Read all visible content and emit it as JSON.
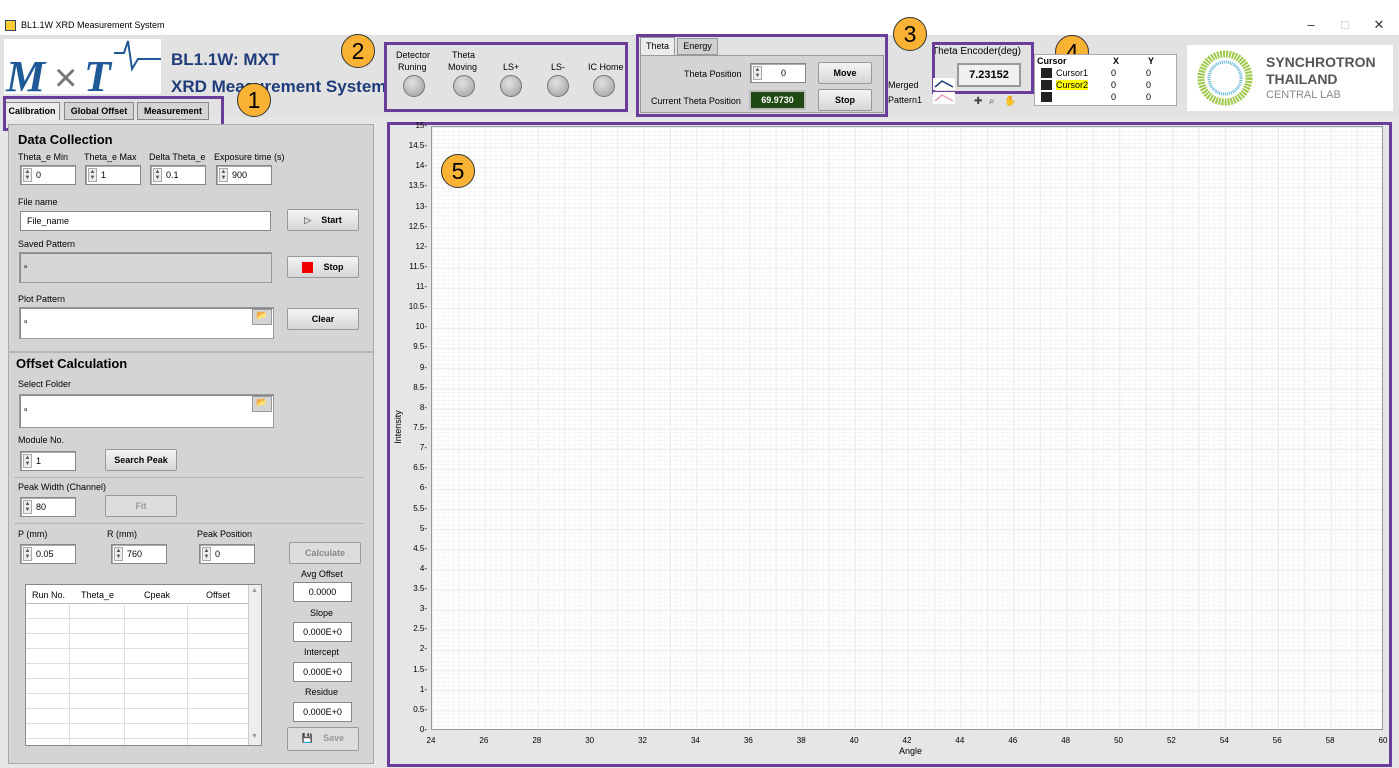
{
  "window": {
    "title": "BL1.1W XRD Measurement System",
    "min": "–",
    "max": "□",
    "close": "✕"
  },
  "header": {
    "line1": "BL1.1W: MXT",
    "line2": "XRD Measurement System"
  },
  "tabs": [
    "Calibration",
    "Global Offset",
    "Measurement"
  ],
  "badges": [
    "1",
    "2",
    "3",
    "4",
    "5"
  ],
  "indicators": [
    {
      "l1": "Detector",
      "l2": "Runing"
    },
    {
      "l1": "Theta",
      "l2": "Moving"
    },
    {
      "l1": "",
      "l2": "LS+"
    },
    {
      "l1": "",
      "l2": "LS-"
    },
    {
      "l1": "",
      "l2": "IC Home"
    }
  ],
  "motor": {
    "tabs": [
      "Theta",
      "Energy"
    ],
    "theta_position_label": "Theta Position",
    "theta_position_value": "0",
    "current_theta_label": "Current Theta Position",
    "current_theta_value": "69.9730",
    "move": "Move",
    "stop": "Stop"
  },
  "encoder": {
    "label": "Theta Encoder(deg)",
    "value": "7.23152"
  },
  "legend": {
    "merged": "Merged",
    "pattern1": "Pattern1"
  },
  "cursors": {
    "header": [
      "Cursor",
      "X",
      "Y"
    ],
    "rows": [
      {
        "name": "Cursor1",
        "x": "0",
        "y": "0"
      },
      {
        "name": "Cursor2",
        "x": "0",
        "y": "0"
      },
      {
        "name": "",
        "x": "0",
        "y": "0"
      }
    ]
  },
  "sponsor": {
    "line1": "SYNCHROTRON",
    "line2": "THAILAND",
    "line3": "CENTRAL LAB"
  },
  "data_collection": {
    "title": "Data Collection",
    "fields": [
      {
        "label": "Theta_e Min",
        "value": "0"
      },
      {
        "label": "Theta_e Max",
        "value": "1"
      },
      {
        "label": "Delta Theta_e",
        "value": "0.1"
      },
      {
        "label": "Exposure time (s)",
        "value": "900"
      }
    ],
    "file_name_label": "File name",
    "file_name": "File_name",
    "start": "Start",
    "saved_pattern_label": "Saved Pattern",
    "stop": "Stop",
    "plot_pattern_label": "Plot Pattern",
    "clear": "Clear"
  },
  "offset": {
    "title": "Offset Calculation",
    "select_folder_label": "Select Folder",
    "module_label": "Module No.",
    "module_value": "1",
    "search_peak": "Search Peak",
    "peak_width_label": "Peak Width (Channel)",
    "peak_width_value": "80",
    "fit": "Fit",
    "p_label": "P (mm)",
    "p_value": "0.05",
    "r_label": "R (mm)",
    "r_value": "760",
    "peak_pos_label": "Peak Position",
    "peak_pos_value": "0",
    "calculate": "Calculate",
    "table_headers": [
      "Run No.",
      "Theta_e",
      "Cpeak",
      "Offset"
    ],
    "avg_offset_label": "Avg Offset",
    "avg_offset": "0.0000",
    "slope_label": "Slope",
    "slope": "0.000E+0",
    "intercept_label": "Intercept",
    "intercept": "0.000E+0",
    "residue_label": "Residue",
    "residue": "0.000E+0",
    "save": "Save"
  },
  "chart_data": {
    "type": "line",
    "xlabel": "Angle",
    "ylabel": "Intensity",
    "xlim": [
      24,
      60
    ],
    "ylim": [
      0,
      15
    ],
    "xticks": [
      "24",
      "26",
      "28",
      "30",
      "32",
      "34",
      "36",
      "38",
      "40",
      "42",
      "44",
      "46",
      "48",
      "50",
      "52",
      "54",
      "56",
      "58",
      "60"
    ],
    "yticks": [
      "0",
      "0.5",
      "1",
      "1.5",
      "2",
      "2.5",
      "3",
      "3.5",
      "4",
      "4.5",
      "5",
      "5.5",
      "6",
      "6.5",
      "7",
      "7.5",
      "8",
      "8.5",
      "9",
      "9.5",
      "10",
      "10.5",
      "11",
      "11.5",
      "12",
      "12.5",
      "13",
      "13.5",
      "14",
      "14.5",
      "15"
    ],
    "grid": true,
    "series": [
      {
        "name": "Merged",
        "x": [],
        "y": []
      },
      {
        "name": "Pattern1",
        "x": [],
        "y": []
      }
    ]
  },
  "colors": {
    "accent": "#6a3d9a",
    "badge": "#f9b233",
    "title_blue": "#1f3c7a",
    "green_display": "#1f4a12"
  }
}
